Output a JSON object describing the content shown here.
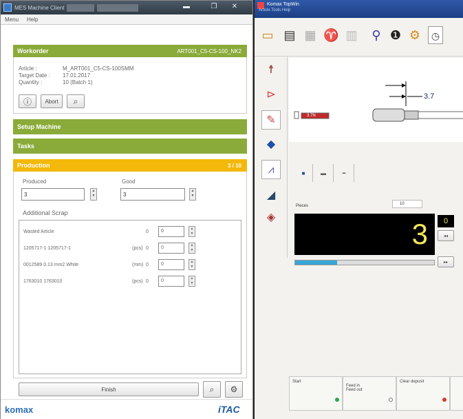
{
  "left_window": {
    "title": "MES Machine Client",
    "menu": [
      "Menu",
      "Help"
    ],
    "workorder": {
      "header": "Workorder",
      "id": "ART001_C5-CS-100_NK2",
      "article_label": "Article :",
      "article_value": "M_ART001_C5-CS-100SMM",
      "target_date_label": "Target Date :",
      "target_date_value": "17.01.2017",
      "quantity_label": "Quantity :",
      "quantity_value": "10 (Batch 1)",
      "abort_label": "Abort"
    },
    "setup_label": "Setup Machine",
    "tasks_label": "Tasks",
    "production": {
      "header": "Production",
      "count": "3 / 10",
      "produced_label": "Produced",
      "good_label": "Good",
      "produced_value": "3",
      "good_value": "3"
    },
    "additional_scrap_label": "Additional Scrap",
    "scrap_rows": [
      {
        "name": "Wasted Article",
        "unit": "",
        "count": "0",
        "value": "0"
      },
      {
        "name": "1205717-1 1205717-1",
        "unit": "(pcs)",
        "count": "0",
        "value": "0"
      },
      {
        "name": "0012589 0.13 mm2 White",
        "unit": "(mm)",
        "count": "0",
        "value": "0"
      },
      {
        "name": "1763010 1763010",
        "unit": "(pcs)",
        "count": "0",
        "value": "0"
      }
    ],
    "finish_label": "Finish",
    "footer_logo": "komax",
    "footer_brand": "iTAC"
  },
  "right_window": {
    "title": "Komax TopWin",
    "menu": "Article  Tools  Help",
    "dimension": "3.7",
    "marker_text": "3.7N",
    "pieces_label": "Pieces",
    "pieces_field": "10",
    "counter_value": "3",
    "side_value": "0",
    "bottom_buttons": [
      {
        "label": "Start"
      },
      {
        "label": "Feed in\nFeed out"
      },
      {
        "label": "Clear deposit"
      }
    ]
  },
  "colors": {
    "green_header": "#8aab3a",
    "yellow_header": "#f3b80a",
    "counter_text": "#f3e65a",
    "titlebar_blue": "#1d3f85"
  }
}
